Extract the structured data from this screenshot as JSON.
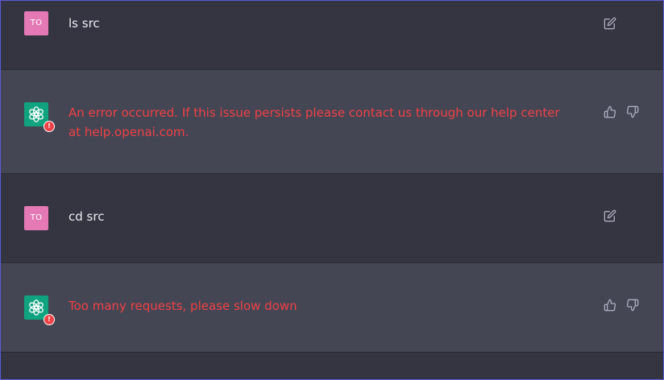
{
  "messages": [
    {
      "role": "user",
      "avatar_initials": "TO",
      "text": "ls src",
      "action_icons": [
        "edit-icon"
      ]
    },
    {
      "role": "assistant",
      "avatar_icon": "openai-logo-icon",
      "error": true,
      "badge": "!",
      "text": "An error occurred. If this issue persists please contact us through our help center at help.openai.com.",
      "action_icons": [
        "thumbs-up-icon",
        "thumbs-down-icon"
      ]
    },
    {
      "role": "user",
      "avatar_initials": "TO",
      "text": "cd src",
      "action_icons": [
        "edit-icon"
      ]
    },
    {
      "role": "assistant",
      "avatar_icon": "openai-logo-icon",
      "error": true,
      "badge": "!",
      "text": "Too many requests, please slow down",
      "action_icons": [
        "thumbs-up-icon",
        "thumbs-down-icon"
      ]
    }
  ],
  "colors": {
    "user_bg": "#343541",
    "assistant_bg": "#444654",
    "user_avatar": "#e479b5",
    "assistant_avatar": "#10a37f",
    "error_text": "#ef4146",
    "icon": "#acacbe"
  }
}
